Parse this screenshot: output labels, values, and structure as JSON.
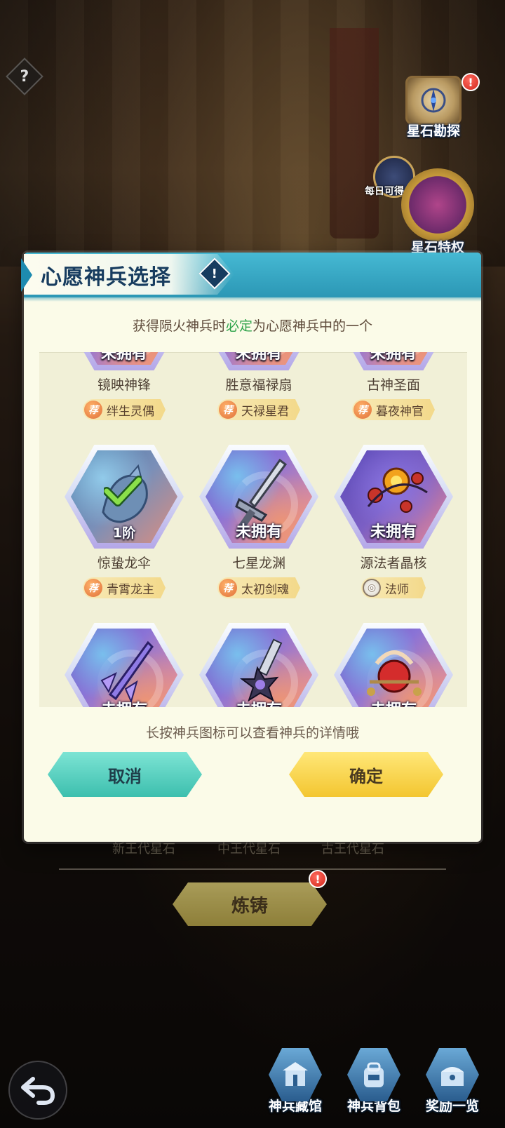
{
  "hud": {
    "help_glyph": "?",
    "star_explore_label": "星石勘探",
    "daily_label": "每日可得",
    "star_special_label": "星石特权",
    "alert_glyph": "!"
  },
  "dialog": {
    "title": "心愿神兵选择",
    "info_glyph": "!",
    "subtitle_before": "获得陨火神兵时",
    "subtitle_highlight": "必定",
    "subtitle_after": "为心愿神兵中的一个",
    "hint": "长按神兵图标可以查看神兵的详情哦",
    "cancel_label": "取消",
    "ok_label": "确定",
    "rec_glyph": "荐",
    "items": [
      {
        "name": "镜映神锋",
        "status": "未拥有",
        "tag": "绊生灵偶",
        "tag_icon": "recommend-icon"
      },
      {
        "name": "胜意福禄扇",
        "status": "未拥有",
        "tag": "天禄星君",
        "tag_icon": "recommend-icon"
      },
      {
        "name": "古神圣面",
        "status": "未拥有",
        "tag": "暮夜神官",
        "tag_icon": "recommend-icon"
      },
      {
        "name": "惊蛰龙伞",
        "status": "1阶",
        "tag": "青霄龙主",
        "tag_icon": "recommend-icon",
        "selected": true
      },
      {
        "name": "七星龙渊",
        "status": "未拥有",
        "tag": "太初剑魂",
        "tag_icon": "recommend-icon"
      },
      {
        "name": "源法者晶核",
        "status": "未拥有",
        "tag": "法师",
        "tag_icon": "mage-class-icon"
      },
      {
        "name": "",
        "status": "未拥有",
        "tag": "",
        "tag_icon": ""
      },
      {
        "name": "",
        "status": "未拥有",
        "tag": "",
        "tag_icon": ""
      },
      {
        "name": "",
        "status": "未拥有",
        "tag": "",
        "tag_icon": ""
      }
    ]
  },
  "under_dialog": {
    "labels": [
      "新王代星石",
      "中王代星石",
      "古王代星石"
    ]
  },
  "forge": {
    "label": "炼铸"
  },
  "bottom_nav": [
    {
      "label": "神兵藏馆",
      "icon": "armory-icon"
    },
    {
      "label": "神兵背包",
      "icon": "backpack-icon"
    },
    {
      "label": "奖励一览",
      "icon": "reward-chest-icon"
    }
  ],
  "colors": {
    "header": "#2b97b5",
    "highlight_green": "#2ea34a",
    "cancel": "#3dbfae",
    "ok": "#f3c630"
  }
}
